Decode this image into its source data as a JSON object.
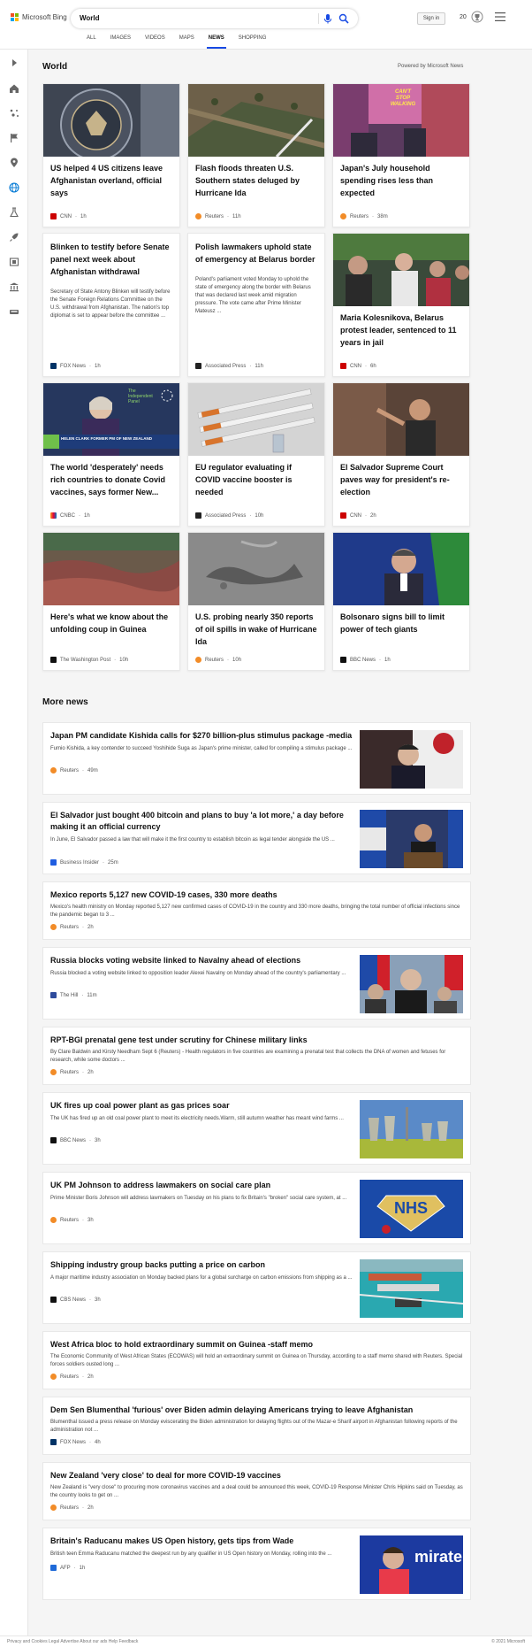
{
  "header": {
    "brand": "Microsoft Bing",
    "query": "World",
    "sign_in": "Sign in",
    "rewards_count": "20",
    "tabs": [
      "ALL",
      "IMAGES",
      "VIDEOS",
      "MAPS",
      "NEWS",
      "SHOPPING"
    ],
    "active_tab": "NEWS"
  },
  "colors": {
    "accent": "#174ae4",
    "rail_active": "#0078d4"
  },
  "world": {
    "title": "World",
    "powered": "Powered by Microsoft News",
    "cards": [
      {
        "title": "US helped 4 US citizens leave Afghanistan overland, official says",
        "source": "CNN",
        "time": "1h",
        "snippet": ""
      },
      {
        "title": "Flash floods threaten U.S. Southern states deluged by Hurricane Ida",
        "source": "Reuters",
        "time": "11h",
        "snippet": ""
      },
      {
        "title": "Japan's July household spending rises less than expected",
        "source": "Reuters",
        "time": "38m",
        "snippet": ""
      },
      {
        "title": "Blinken to testify before Senate panel next week about Afghanistan withdrawal",
        "source": "FOX News",
        "time": "1h",
        "snippet": "Secretary of State Antony Blinken will testify before the Senate Foreign Relations Committee on the U.S. withdrawal from Afghanistan. The nation's top diplomat is set to appear before the committee ..."
      },
      {
        "title": "Polish lawmakers uphold state of emergency at Belarus border",
        "source": "Associated Press",
        "time": "11h",
        "snippet": "Poland's parliament voted Monday to uphold the state of emergency along the border with Belarus that was declared last week amid migration pressure. The vote came after Prime Minister Mateusz ..."
      },
      {
        "title": "Maria Kolesnikova, Belarus protest leader, sentenced to 11 years in jail",
        "source": "CNN",
        "time": "6h",
        "snippet": ""
      },
      {
        "title": "The world 'desperately' needs rich countries to donate Covid vaccines, says former New...",
        "source": "CNBC",
        "time": "1h",
        "snippet": ""
      },
      {
        "title": "EU regulator evaluating if COVID vaccine booster is needed",
        "source": "Associated Press",
        "time": "10h",
        "snippet": ""
      },
      {
        "title": "El Salvador Supreme Court paves way for president's re-election",
        "source": "CNN",
        "time": "2h",
        "snippet": ""
      },
      {
        "title": "Here's what we know about the unfolding coup in Guinea",
        "source": "The Washington Post",
        "time": "10h",
        "snippet": ""
      },
      {
        "title": "U.S. probing nearly 350 reports of oil spills in wake of Hurricane Ida",
        "source": "Reuters",
        "time": "10h",
        "snippet": ""
      },
      {
        "title": "Bolsonaro signs bill to limit power of tech giants",
        "source": "BBC News",
        "time": "1h",
        "snippet": ""
      }
    ],
    "image_texts": {
      "sign": "CAN'T STOP WALKING",
      "tv_caption": "HELEN CLARK FORMER PM OF NEW ZEALAND",
      "tv_logo": "The Independent Panel"
    }
  },
  "more": {
    "title": "More news",
    "items": [
      {
        "title": "Japan PM candidate Kishida calls for $270 billion-plus stimulus package -media",
        "snippet": "Fumio Kishida, a key contender to succeed Yoshihide Suga as Japan's prime minister, called for compiling a stimulus package ...",
        "source": "Reuters",
        "time": "49m"
      },
      {
        "title": "El Salvador just bought 400 bitcoin and plans to buy 'a lot more,' a day before making it an official currency",
        "snippet": "In June, El Salvador passed a law that will make it the first country to establish bitcoin as legal tender alongside the US ...",
        "source": "Business Insider",
        "time": "25m"
      },
      {
        "title": "Mexico reports 5,127 new COVID-19 cases, 330 more deaths",
        "snippet": "Mexico's health ministry on Monday reported 5,127 new confirmed cases of COVID-19 in the country and 330 more deaths, bringing the total number of official infections since the pandemic began to 3 ...",
        "source": "Reuters",
        "time": "2h"
      },
      {
        "title": "Russia blocks voting website linked to Navalny ahead of elections",
        "snippet": "Russia blocked a voting website linked to opposition leader Alexei Navalny on Monday ahead of the country's parliamentary ...",
        "source": "The Hill",
        "time": "11m"
      },
      {
        "title": "RPT-BGI prenatal gene test under scrutiny for Chinese military links",
        "snippet": "By Clare Baldwin and Kirsty Needham Sept 6 (Reuters) - Health regulators in five countries are examining a prenatal test that collects the DNA of women and fetuses for research, while some doctors ...",
        "source": "Reuters",
        "time": "2h"
      },
      {
        "title": "UK fires up coal power plant as gas prices soar",
        "snippet": "The UK has fired up an old coal power plant to meet its electricity needs.Warm, still autumn weather has meant wind farms ...",
        "source": "BBC News",
        "time": "3h"
      },
      {
        "title": "UK PM Johnson to address lawmakers on social care plan",
        "snippet": "Prime Minister Boris Johnson will address lawmakers on Tuesday on his plans to fix Britain's \"broken\" social care system, at ...",
        "source": "Reuters",
        "time": "3h"
      },
      {
        "title": "Shipping industry group backs putting a price on carbon",
        "snippet": "A major maritime industry association on Monday backed plans for a global surcharge on carbon emissions from shipping as a ...",
        "source": "CBS News",
        "time": "3h"
      },
      {
        "title": "West Africa bloc to hold extraordinary summit on Guinea -staff memo",
        "snippet": "The Economic Community of West African States (ECOWAS) will hold an extraordinary summit on Guinea on Thursday, according to a staff memo shared with Reuters. Special forces soldiers ousted long ...",
        "source": "Reuters",
        "time": "2h"
      },
      {
        "title": "Dem Sen Blumenthal 'furious' over Biden admin delaying Americans trying to leave Afghanistan",
        "snippet": "Blumenthal issued a press release on Monday eviscerating the Biden administration for delaying flights out of the Mazar-e Sharif airport in Afghanistan following reports of the administration not ...",
        "source": "FOX News",
        "time": "4h"
      },
      {
        "title": "New Zealand 'very close' to deal for more COVID-19 vaccines",
        "snippet": "New Zealand is \"very close\" to procuring more coronavirus vaccines and a deal could be announced this week, COVID-19 Response Minister Chris Hipkins said on Tuesday, as the country looks to get on ...",
        "source": "Reuters",
        "time": "2h"
      },
      {
        "title": "Britain's Raducanu makes US Open history, gets tips from Wade",
        "snippet": "British teen Emma Raducanu matched the deepest run by any qualifier in US Open history on Monday, rolling into the ...",
        "source": "AFP",
        "time": "1h"
      }
    ],
    "image_texts": {
      "emirates": "mirate"
    }
  },
  "footer": {
    "left": "Privacy and Cookies   Legal   Advertise   About our ads   Help   Feedback",
    "right": "© 2021 Microsoft"
  }
}
